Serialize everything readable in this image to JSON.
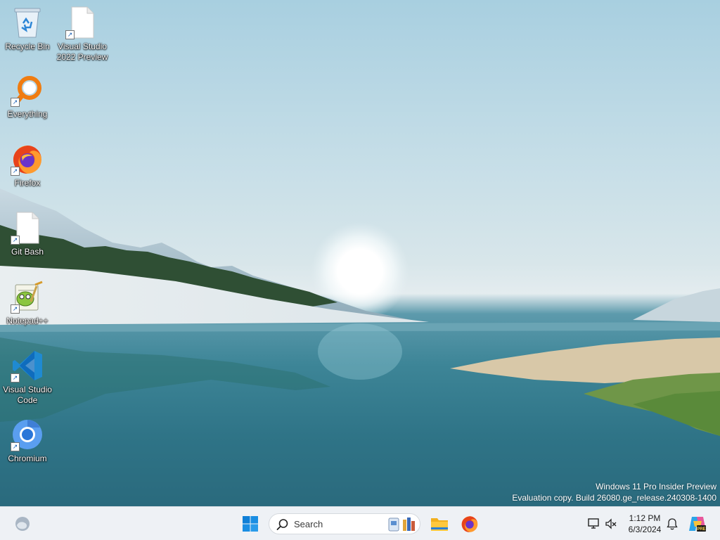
{
  "desktop": {
    "icons": [
      {
        "label": "Recycle Bin",
        "icon": "recycle-bin-icon"
      },
      {
        "label": "Visual Studio\n2022 Preview",
        "icon": "blank-file-icon"
      },
      {
        "label": "Everything",
        "icon": "everything-search-icon"
      },
      {
        "label": "Firefox",
        "icon": "firefox-icon"
      },
      {
        "label": "Git Bash",
        "icon": "blank-file-icon"
      },
      {
        "label": "Notepad++",
        "icon": "notepad-plus-plus-icon"
      },
      {
        "label": "Visual Studio\nCode",
        "icon": "vscode-icon"
      },
      {
        "label": "Chromium",
        "icon": "chromium-icon"
      }
    ],
    "watermark": {
      "line1": "Windows 11 Pro Insider Preview",
      "line2": "Evaluation copy. Build 26080.ge_release.240308-1400"
    }
  },
  "taskbar": {
    "search_placeholder": "Search",
    "pinned": [
      "start-icon",
      "file-explorer-icon",
      "firefox-icon"
    ],
    "clock": {
      "time": "1:12 PM",
      "date": "6/3/2024"
    },
    "colors": {
      "accent": "#0067c0",
      "taskbar_bg": "#eef1f5"
    }
  }
}
